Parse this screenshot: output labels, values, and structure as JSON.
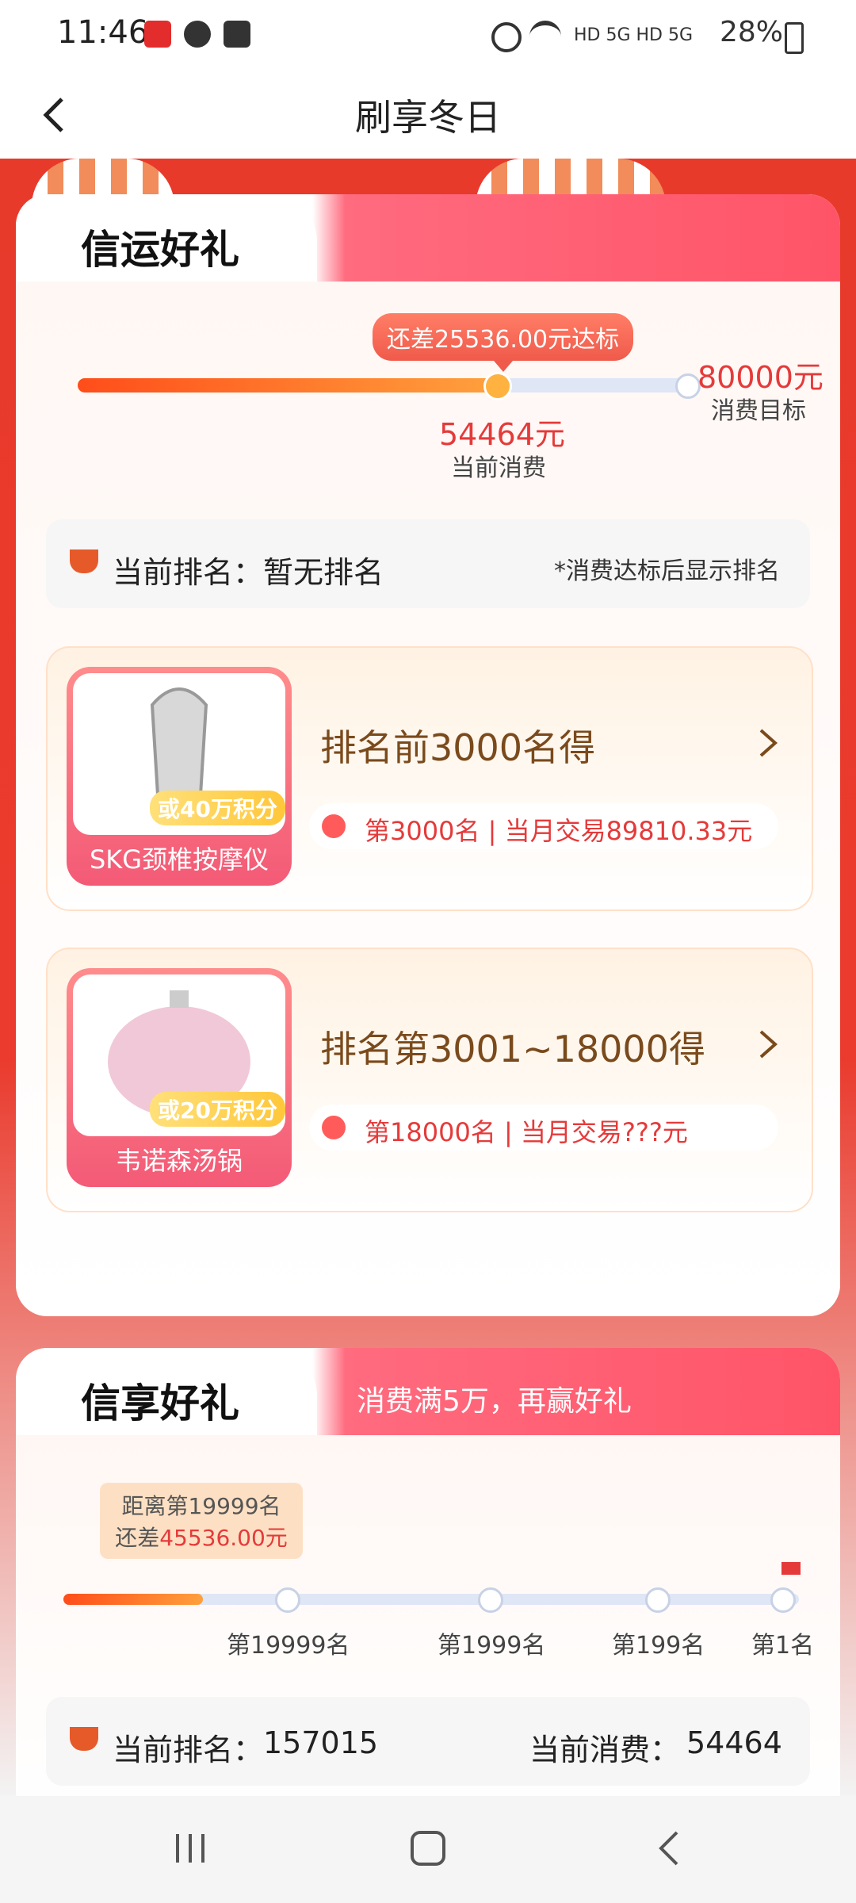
{
  "status_bar": {
    "time": "11:46",
    "indicators": "HD 5G HD 5G",
    "battery": "28%"
  },
  "header": {
    "title": "刷享冬日"
  },
  "card1": {
    "title": "信运好礼",
    "progress": {
      "gap_label": "还差25536.00元达标",
      "target_value": "80000元",
      "target_label": "消费目标",
      "current_value": "54464元",
      "current_label": "当前消费",
      "fraction": 0.6808
    },
    "rank": {
      "label": "当前排名：",
      "value": "暂无排名",
      "note": "*消费达标后显示排名"
    },
    "gifts": [
      {
        "name": "SKG颈椎按摩仪",
        "points": "或40万积分",
        "title": "排名前3000名得",
        "info": "第3000名 | 当月交易89810.33元"
      },
      {
        "name": "韦诺森汤锅",
        "points": "或20万积分",
        "title": "排名第3001~18000得",
        "info": "第18000名 | 当月交易???元"
      }
    ]
  },
  "card2": {
    "title": "信享好礼",
    "subtitle": "消费满5万，再赢好礼",
    "tooltip": {
      "line1": "距离第19999名",
      "line2_prefix": "还差",
      "line2_value": "45536.00元"
    },
    "milestones": [
      "第19999名",
      "第1999名",
      "第199名",
      "第1名"
    ],
    "rank": {
      "label": "当前排名：",
      "value": "157015"
    },
    "spend": {
      "label": "当前消费：",
      "value": "54464"
    }
  },
  "colors": {
    "accent_red": "#e53a3a",
    "brand_red": "#ea3b2e",
    "gift_title": "#7a4a1c"
  }
}
